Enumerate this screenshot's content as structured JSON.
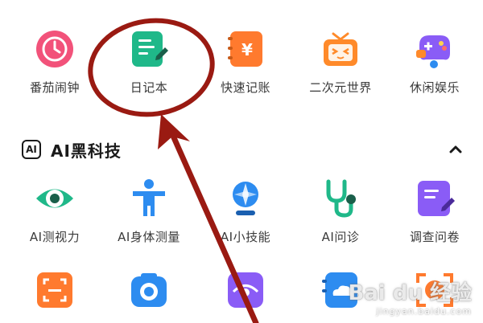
{
  "apps_row1": [
    {
      "label": "番茄闹钟",
      "icon": "tomato-clock-icon",
      "color": "#f2527a"
    },
    {
      "label": "日记本",
      "icon": "diary-icon",
      "color": "#1fb889"
    },
    {
      "label": "快速记账",
      "icon": "bookkeeping-icon",
      "color": "#ff7a2e"
    },
    {
      "label": "二次元世界",
      "icon": "tv-icon",
      "color": "#ff8a2a"
    },
    {
      "label": "休闲娱乐",
      "icon": "gamepad-icon",
      "color": "#8a5cf6"
    }
  ],
  "section": {
    "badge": "AI",
    "title": "AI黑科技",
    "collapse_icon": "chevron-up-icon"
  },
  "apps_row2": [
    {
      "label": "AI测视力",
      "icon": "eye-test-icon",
      "color": "#1fb889"
    },
    {
      "label": "AI身体测量",
      "icon": "body-measure-icon",
      "color": "#2d8cf0"
    },
    {
      "label": "AI小技能",
      "icon": "skills-icon",
      "color": "#2d8cf0"
    },
    {
      "label": "AI问诊",
      "icon": "stethoscope-icon",
      "color": "#1fb889"
    },
    {
      "label": "调查问卷",
      "icon": "survey-icon",
      "color": "#8a5cf6"
    }
  ],
  "apps_row3": [
    {
      "icon": "scan-icon",
      "color": "#ff7a2e"
    },
    {
      "icon": "camera-icon",
      "color": "#2d8cf0"
    },
    {
      "icon": "eye-icon",
      "color": "#8a5cf6"
    },
    {
      "icon": "cloud-icon",
      "color": "#2d8cf0"
    },
    {
      "icon": "face-scan-icon",
      "color": "#ff7a2e"
    }
  ],
  "annotation_color": "#9a1a12",
  "watermark": {
    "main": "Bai du 经验",
    "sub": "jingyan.baidu.com"
  }
}
